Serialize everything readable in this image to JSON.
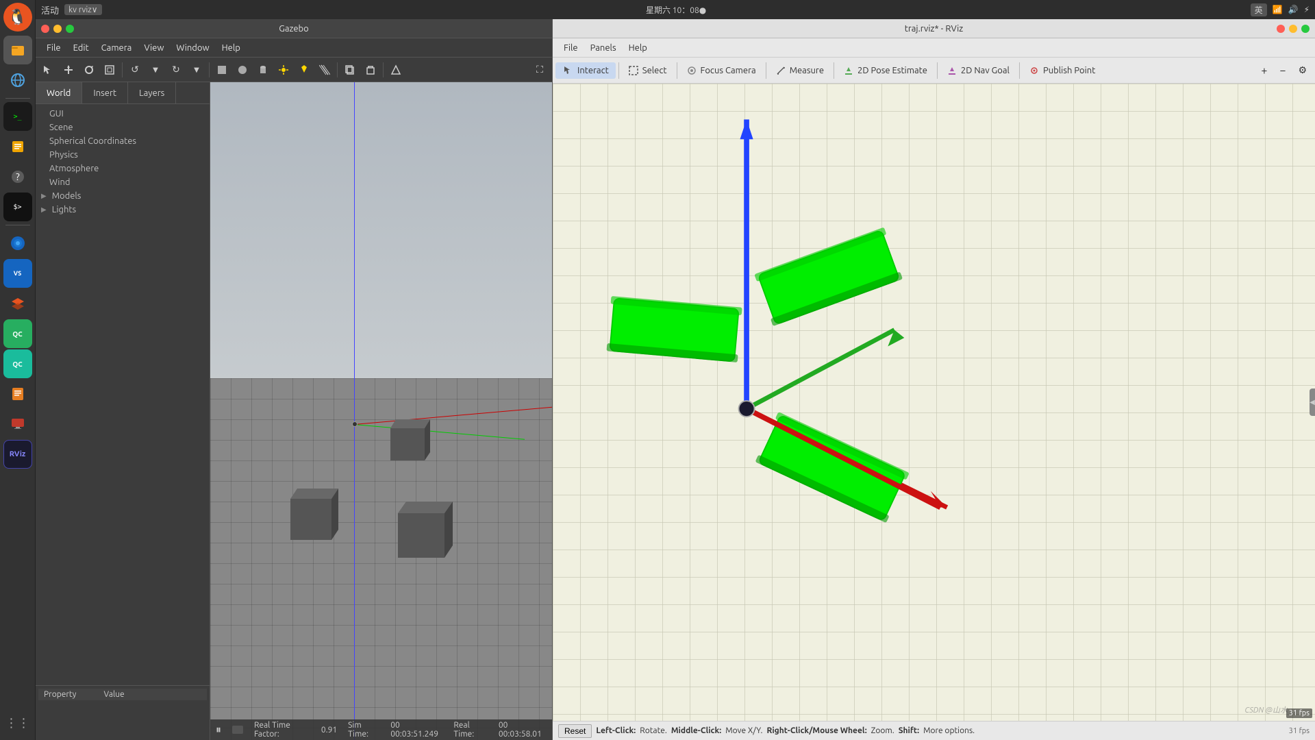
{
  "system": {
    "title": "Gazebo",
    "rviz_title": "traj.rviz* - RViz",
    "datetime": "星期六 10：08●",
    "lang": "英",
    "app_name": "活动"
  },
  "gazebo": {
    "menu": {
      "file": "File",
      "edit": "Edit",
      "camera": "Camera",
      "view": "View",
      "window": "Window",
      "help": "Help"
    },
    "world_tabs": {
      "world": "World",
      "insert": "Insert",
      "layers": "Layers"
    },
    "tree": {
      "gui": "GUI",
      "scene": "Scene",
      "spherical_coordinates": "Spherical Coordinates",
      "physics": "Physics",
      "atmosphere": "Atmosphere",
      "wind": "Wind",
      "models": "Models",
      "lights": "Lights"
    },
    "property_headers": {
      "property": "Property",
      "value": "Value"
    },
    "statusbar": {
      "real_time_factor_label": "Real Time Factor:",
      "real_time_factor_value": "0.91",
      "sim_time_label": "Sim Time:",
      "sim_time_value": "00 00:03:51.249",
      "real_time_label": "Real Time:",
      "real_time_value": "00 00:03:58.01"
    }
  },
  "rviz": {
    "menu": {
      "file": "File",
      "panels": "Panels",
      "help": "Help"
    },
    "toolbar": {
      "interact": "Interact",
      "select": "Select",
      "focus_camera": "Focus Camera",
      "measure": "Measure",
      "pose_estimate": "2D Pose Estimate",
      "nav_goal": "2D Nav Goal",
      "publish_point": "Publish Point"
    },
    "statusbar": {
      "reset": "Reset",
      "left_click": "Left-Click:",
      "left_click_action": "Rotate.",
      "middle_click": "Middle-Click:",
      "middle_click_action": "Move X/Y.",
      "right_click": "Right-Click/Mouse Wheel:",
      "right_click_action": "Zoom.",
      "shift": "Shift:",
      "shift_action": "More options.",
      "fps": "31 fps"
    }
  },
  "taskbar": {
    "items": [
      {
        "name": "ubuntu-logo",
        "icon": "🐧"
      },
      {
        "name": "files",
        "icon": "📁"
      },
      {
        "name": "browser",
        "icon": "🌐"
      },
      {
        "name": "terminal",
        "icon": ">_"
      },
      {
        "name": "code",
        "icon": "⟨/⟩"
      },
      {
        "name": "layers",
        "icon": "◼"
      },
      {
        "name": "docs",
        "icon": "📄"
      },
      {
        "name": "settings",
        "icon": "⚙"
      },
      {
        "name": "help",
        "icon": "?"
      },
      {
        "name": "shell",
        "icon": "$"
      },
      {
        "name": "globe",
        "icon": "🌍"
      },
      {
        "name": "vscode",
        "icon": "VS"
      },
      {
        "name": "qc1",
        "icon": "QC"
      },
      {
        "name": "qc2",
        "icon": "QC"
      },
      {
        "name": "notes",
        "icon": "📝"
      },
      {
        "name": "screen",
        "icon": "🖥"
      },
      {
        "name": "rviz",
        "icon": "RViz"
      },
      {
        "name": "apps",
        "icon": "⋮⋮"
      }
    ]
  }
}
